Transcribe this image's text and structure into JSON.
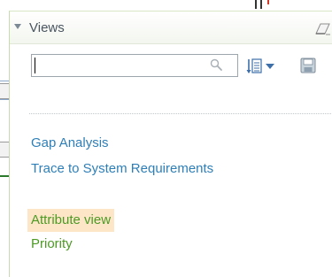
{
  "panel": {
    "title": "Views"
  },
  "toolbar": {
    "filter": {
      "value": "",
      "placeholder": ""
    },
    "icons": [
      "search-icon",
      "sort-list-icon",
      "chevron-down-icon",
      "save-icon",
      "eraser-icon",
      "collapse-triangle-icon"
    ]
  },
  "views": [
    {
      "label": "Gap Analysis"
    },
    {
      "label": "Trace to System Requirements"
    }
  ],
  "attribute_views": [
    {
      "label": "Attribute view",
      "highlighted": true
    },
    {
      "label": "Priority"
    }
  ],
  "colors": {
    "link_blue": "#2e7fb8",
    "attr_green": "#4c9a23",
    "highlight": "#fde6c8",
    "panel_border": "#c6dcab"
  }
}
